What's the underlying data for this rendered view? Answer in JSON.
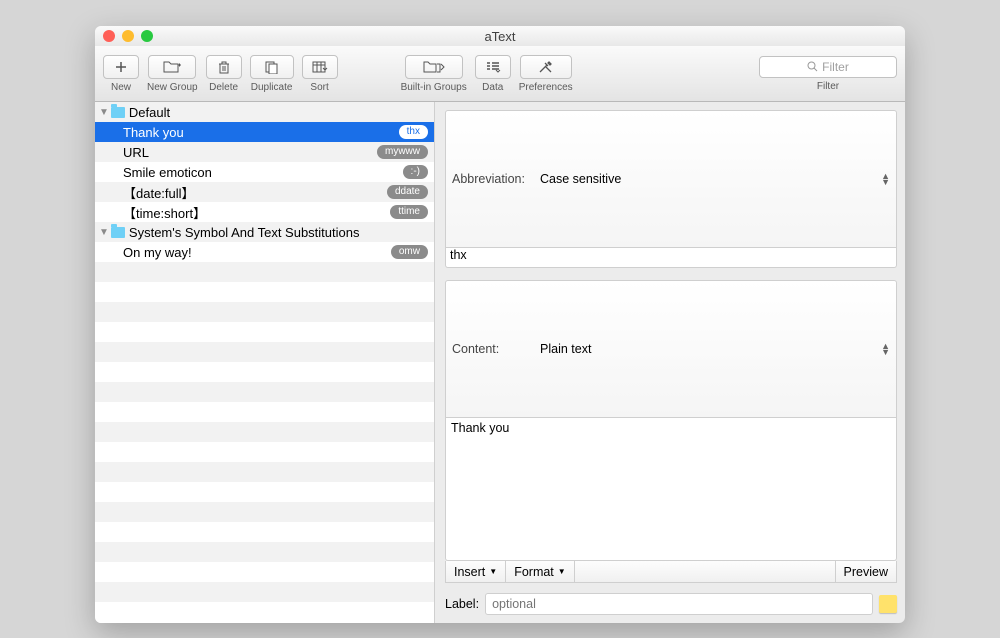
{
  "window": {
    "title": "aText"
  },
  "toolbar": {
    "new": "New",
    "newgroup": "New Group",
    "delete": "Delete",
    "duplicate": "Duplicate",
    "sort": "Sort",
    "builtin": "Built-in Groups",
    "data": "Data",
    "prefs": "Preferences",
    "filter_label": "Filter",
    "filter_placeholder": "Filter"
  },
  "sidebar": {
    "groups": [
      {
        "name": "Default",
        "items": [
          {
            "label": "Thank you",
            "badge": "thx",
            "selected": true
          },
          {
            "label": "URL",
            "badge": "mywww"
          },
          {
            "label": "Smile emoticon",
            "badge": ":-)"
          },
          {
            "label": "【date:full】",
            "badge": "ddate"
          },
          {
            "label": "【time:short】",
            "badge": "ttime"
          }
        ]
      },
      {
        "name": "System's Symbol And Text Substitutions",
        "items": [
          {
            "label": "On my way!",
            "badge": "omw"
          }
        ]
      }
    ]
  },
  "detail": {
    "abbr_label": "Abbreviation:",
    "abbr_mode": "Case sensitive",
    "abbr_value": "thx",
    "content_label": "Content:",
    "content_mode": "Plain text",
    "content_value": "Thank you",
    "insert": "Insert",
    "format": "Format",
    "preview": "Preview",
    "label_label": "Label:",
    "label_placeholder": "optional"
  }
}
